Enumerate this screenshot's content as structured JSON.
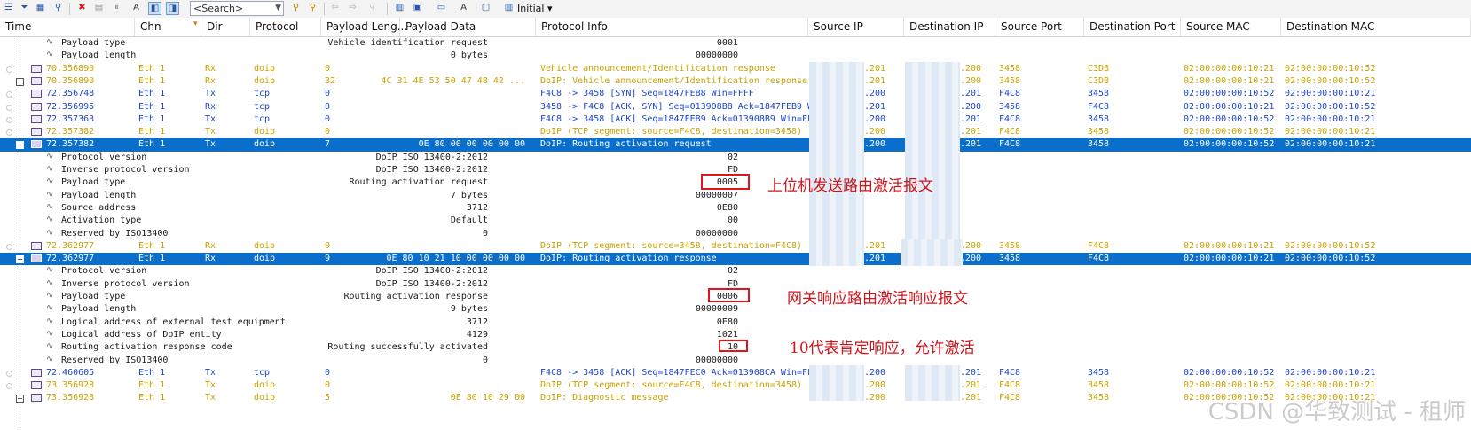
{
  "toolbar": {
    "search_placeholder": "<Search>",
    "initial_label": "Initial",
    "icons": [
      "view-icon",
      "filter-icon",
      "color-icon",
      "find-icon",
      "stop-icon",
      "page-icon",
      "pause-icon",
      "text-icon",
      "toggle-a-icon",
      "toggle-b-icon",
      "search-next-icon",
      "search-prev-icon",
      "back-icon",
      "forward-icon",
      "jump-icon",
      "columns-icon",
      "export-icon",
      "layout-icon",
      "font-icon",
      "window-icon",
      "config-icon"
    ]
  },
  "columns": [
    "Time",
    "Chn",
    "Dir",
    "Protocol",
    "Payload Leng...",
    "Payload Data",
    "Protocol Info",
    "Source IP",
    "Destination IP",
    "Source Port",
    "Destination Port",
    "Source MAC",
    "Destination MAC"
  ],
  "rows": [
    {
      "kind": "detail",
      "label": "Payload type",
      "mid": "Vehicle identification request",
      "val": "0001"
    },
    {
      "kind": "detail",
      "label": "Payload length",
      "mid": "0 bytes",
      "val": "00000000"
    },
    {
      "kind": "packet",
      "color": "yellow",
      "exp": "",
      "time": "70.356890",
      "chn": "Eth 1",
      "dir": "Rx",
      "proto": "doip",
      "len": "0",
      "data": "",
      "info": "Vehicle announcement/Identification response",
      "sip": ".201",
      "dip": ".200",
      "sport": "3458",
      "dport": "C3DB",
      "smac": "02:00:00:00:10:21",
      "dmac": "02:00:00:00:10:52"
    },
    {
      "kind": "packet",
      "color": "yellow",
      "exp": "+",
      "time": "70.356890",
      "chn": "Eth 1",
      "dir": "Rx",
      "proto": "doip",
      "len": "32",
      "data": "4C 31 4E 53 50 47 48 42  ...",
      "info": "DoIP: Vehicle announcement/Identification response",
      "sip": ".201",
      "dip": ".200",
      "sport": "3458",
      "dport": "C3DB",
      "smac": "02:00:00:00:10:21",
      "dmac": "02:00:00:00:10:52"
    },
    {
      "kind": "packet",
      "color": "blue",
      "exp": "",
      "time": "72.356748",
      "chn": "Eth 1",
      "dir": "Tx",
      "proto": "tcp",
      "len": "0",
      "data": "",
      "info": "F4C8 -> 3458 [SYN] Seq=1847FEB8 Win=FFFF",
      "sip": ".200",
      "dip": ".201",
      "sport": "F4C8",
      "dport": "3458",
      "smac": "02:00:00:00:10:52",
      "dmac": "02:00:00:00:10:21"
    },
    {
      "kind": "packet",
      "color": "blue",
      "exp": "",
      "time": "72.356995",
      "chn": "Eth 1",
      "dir": "Rx",
      "proto": "tcp",
      "len": "0",
      "data": "",
      "info": "3458 -> F4C8 [ACK, SYN] Seq=013908B8 Ack=1847FEB9 Win=...",
      "sip": ".201",
      "dip": ".200",
      "sport": "3458",
      "dport": "F4C8",
      "smac": "02:00:00:00:10:21",
      "dmac": "02:00:00:00:10:52"
    },
    {
      "kind": "packet",
      "color": "blue",
      "exp": "",
      "time": "72.357363",
      "chn": "Eth 1",
      "dir": "Tx",
      "proto": "tcp",
      "len": "0",
      "data": "",
      "info": "F4C8 -> 3458 [ACK] Seq=1847FEB9 Ack=013908B9 Win=FFFF",
      "sip": ".200",
      "dip": ".201",
      "sport": "F4C8",
      "dport": "3458",
      "smac": "02:00:00:00:10:52",
      "dmac": "02:00:00:00:10:21"
    },
    {
      "kind": "packet",
      "color": "yellow",
      "exp": "",
      "time": "72.357382",
      "chn": "Eth 1",
      "dir": "Tx",
      "proto": "doip",
      "len": "0",
      "data": "",
      "info": "DoIP (TCP segment: source=F4C8, destination=3458)",
      "sip": ".200",
      "dip": ".201",
      "sport": "F4C8",
      "dport": "3458",
      "smac": "02:00:00:00:10:52",
      "dmac": "02:00:00:00:10:21"
    },
    {
      "kind": "packet",
      "color": "sel",
      "exp": "−",
      "time": "72.357382",
      "chn": "Eth 1",
      "dir": "Tx",
      "proto": "doip",
      "len": "7",
      "data": "0E 80 00 00 00 00 00",
      "info": "DoIP: Routing activation request",
      "sip": ".200",
      "dip": ".201",
      "sport": "F4C8",
      "dport": "3458",
      "smac": "02:00:00:00:10:52",
      "dmac": "02:00:00:00:10:21"
    },
    {
      "kind": "detail",
      "label": "Protocol version",
      "mid": "DoIP ISO 13400-2:2012",
      "val": "02"
    },
    {
      "kind": "detail",
      "label": "Inverse protocol version",
      "mid": "DoIP ISO 13400-2:2012",
      "val": "FD"
    },
    {
      "kind": "detail",
      "label": "Payload type",
      "mid": "Routing activation request",
      "val": "0005"
    },
    {
      "kind": "detail",
      "label": "Payload length",
      "mid": "7 bytes",
      "val": "00000007"
    },
    {
      "kind": "detail",
      "label": "Source address",
      "mid": "3712",
      "val": "0E80"
    },
    {
      "kind": "detail",
      "label": "Activation type",
      "mid": "Default",
      "val": "00"
    },
    {
      "kind": "detail",
      "label": "Reserved by ISO13400",
      "mid": "0",
      "val": "00000000"
    },
    {
      "kind": "packet",
      "color": "yellow",
      "exp": "",
      "time": "72.362977",
      "chn": "Eth 1",
      "dir": "Rx",
      "proto": "doip",
      "len": "0",
      "data": "",
      "info": "DoIP (TCP segment: source=3458, destination=F4C8)",
      "sip": ".201",
      "dip": ".200",
      "sport": "3458",
      "dport": "F4C8",
      "smac": "02:00:00:00:10:21",
      "dmac": "02:00:00:00:10:52"
    },
    {
      "kind": "packet",
      "color": "sel",
      "exp": "−",
      "time": "72.362977",
      "chn": "Eth 1",
      "dir": "Rx",
      "proto": "doip",
      "len": "9",
      "data": "0E 80 10 21 10 00 00 00 00",
      "info": "DoIP: Routing activation response",
      "sip": ".201",
      "dip": ".200",
      "sport": "3458",
      "dport": "F4C8",
      "smac": "02:00:00:00:10:21",
      "dmac": "02:00:00:00:10:52"
    },
    {
      "kind": "detail",
      "label": "Protocol version",
      "mid": "DoIP ISO 13400-2:2012",
      "val": "02"
    },
    {
      "kind": "detail",
      "label": "Inverse protocol version",
      "mid": "DoIP ISO 13400-2:2012",
      "val": "FD"
    },
    {
      "kind": "detail",
      "label": "Payload type",
      "mid": "Routing activation response",
      "val": "0006"
    },
    {
      "kind": "detail",
      "label": "Payload length",
      "mid": "9 bytes",
      "val": "00000009"
    },
    {
      "kind": "detail",
      "label": "Logical address of external test equipment",
      "mid": "3712",
      "val": "0E80"
    },
    {
      "kind": "detail",
      "label": "Logical address of DoIP entity",
      "mid": "4129",
      "val": "1021"
    },
    {
      "kind": "detail",
      "label": "Routing activation response code",
      "mid": "Routing successfully activated",
      "val": "10"
    },
    {
      "kind": "detail",
      "label": "Reserved by ISO13400",
      "mid": "0",
      "val": "00000000"
    },
    {
      "kind": "packet",
      "color": "blue",
      "exp": "",
      "time": "72.460605",
      "chn": "Eth 1",
      "dir": "Tx",
      "proto": "tcp",
      "len": "0",
      "data": "",
      "info": "F4C8 -> 3458 [ACK] Seq=1847FEC0 Ack=013908CA Win=FFFF",
      "sip": ".200",
      "dip": ".201",
      "sport": "F4C8",
      "dport": "3458",
      "smac": "02:00:00:00:10:52",
      "dmac": "02:00:00:00:10:21"
    },
    {
      "kind": "packet",
      "color": "yellow",
      "exp": "",
      "time": "73.356928",
      "chn": "Eth 1",
      "dir": "Tx",
      "proto": "doip",
      "len": "0",
      "data": "",
      "info": "DoIP (TCP segment: source=F4C8, destination=3458)",
      "sip": ".200",
      "dip": ".201",
      "sport": "F4C8",
      "dport": "3458",
      "smac": "02:00:00:00:10:52",
      "dmac": "02:00:00:00:10:21"
    },
    {
      "kind": "packet",
      "color": "yellow",
      "exp": "+",
      "time": "73.356928",
      "chn": "Eth 1",
      "dir": "Tx",
      "proto": "doip",
      "len": "5",
      "data": "0E 80 10 29 00",
      "info": "DoIP: Diagnostic message",
      "sip": ".200",
      "dip": ".201",
      "sport": "F4C8",
      "dport": "3458",
      "smac": "02:00:00:00:10:52",
      "dmac": "02:00:00:00:10:21"
    }
  ],
  "annotations": {
    "request": "上位机发送路由激活报文",
    "response": "网关响应路由激活响应报文",
    "code": "10代表肯定响应，允许激活"
  },
  "watermark": "CSDN @华致测试 - 租师"
}
